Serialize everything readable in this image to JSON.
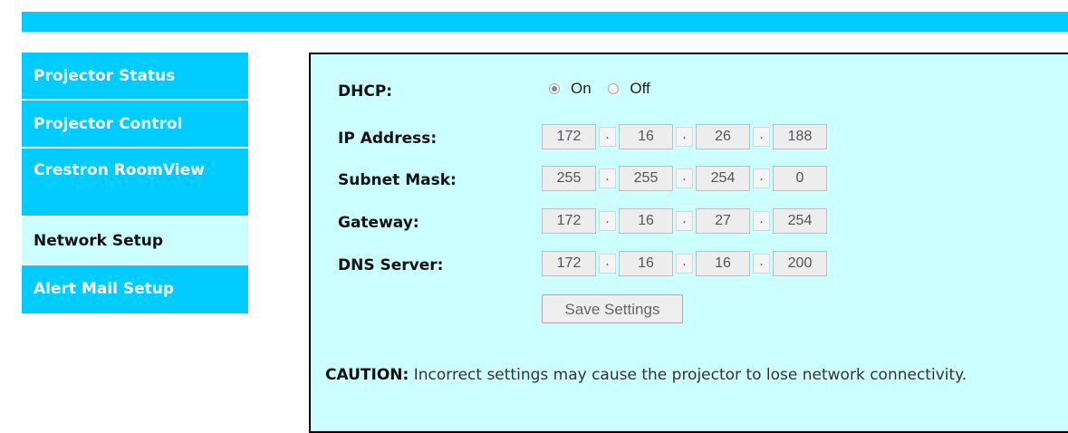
{
  "colors": {
    "accent": "#00ccff",
    "panel_bg": "#ccffff",
    "active_nav_bg": "#ccffff"
  },
  "sidebar": {
    "items": [
      {
        "label": "Projector Status",
        "active": false
      },
      {
        "label": "Projector Control",
        "active": false
      },
      {
        "label": "Crestron RoomView",
        "active": false
      },
      {
        "label": "Network Setup",
        "active": true
      },
      {
        "label": "Alert Mail Setup",
        "active": false
      }
    ]
  },
  "dhcp": {
    "label": "DHCP:",
    "options": [
      "On",
      "Off"
    ],
    "selected": "On"
  },
  "fields": {
    "ip": {
      "label": "IP Address:",
      "octets": [
        "172",
        "16",
        "26",
        "188"
      ]
    },
    "subnet": {
      "label": "Subnet Mask:",
      "octets": [
        "255",
        "255",
        "254",
        "0"
      ]
    },
    "gateway": {
      "label": "Gateway:",
      "octets": [
        "172",
        "16",
        "27",
        "254"
      ]
    },
    "dns": {
      "label": "DNS Server:",
      "octets": [
        "172",
        "16",
        "16",
        "200"
      ]
    }
  },
  "separator": ".",
  "save_label": "Save Settings",
  "caution": {
    "title": "CAUTION:",
    "text": " Incorrect settings may cause the projector to lose network connectivity."
  }
}
